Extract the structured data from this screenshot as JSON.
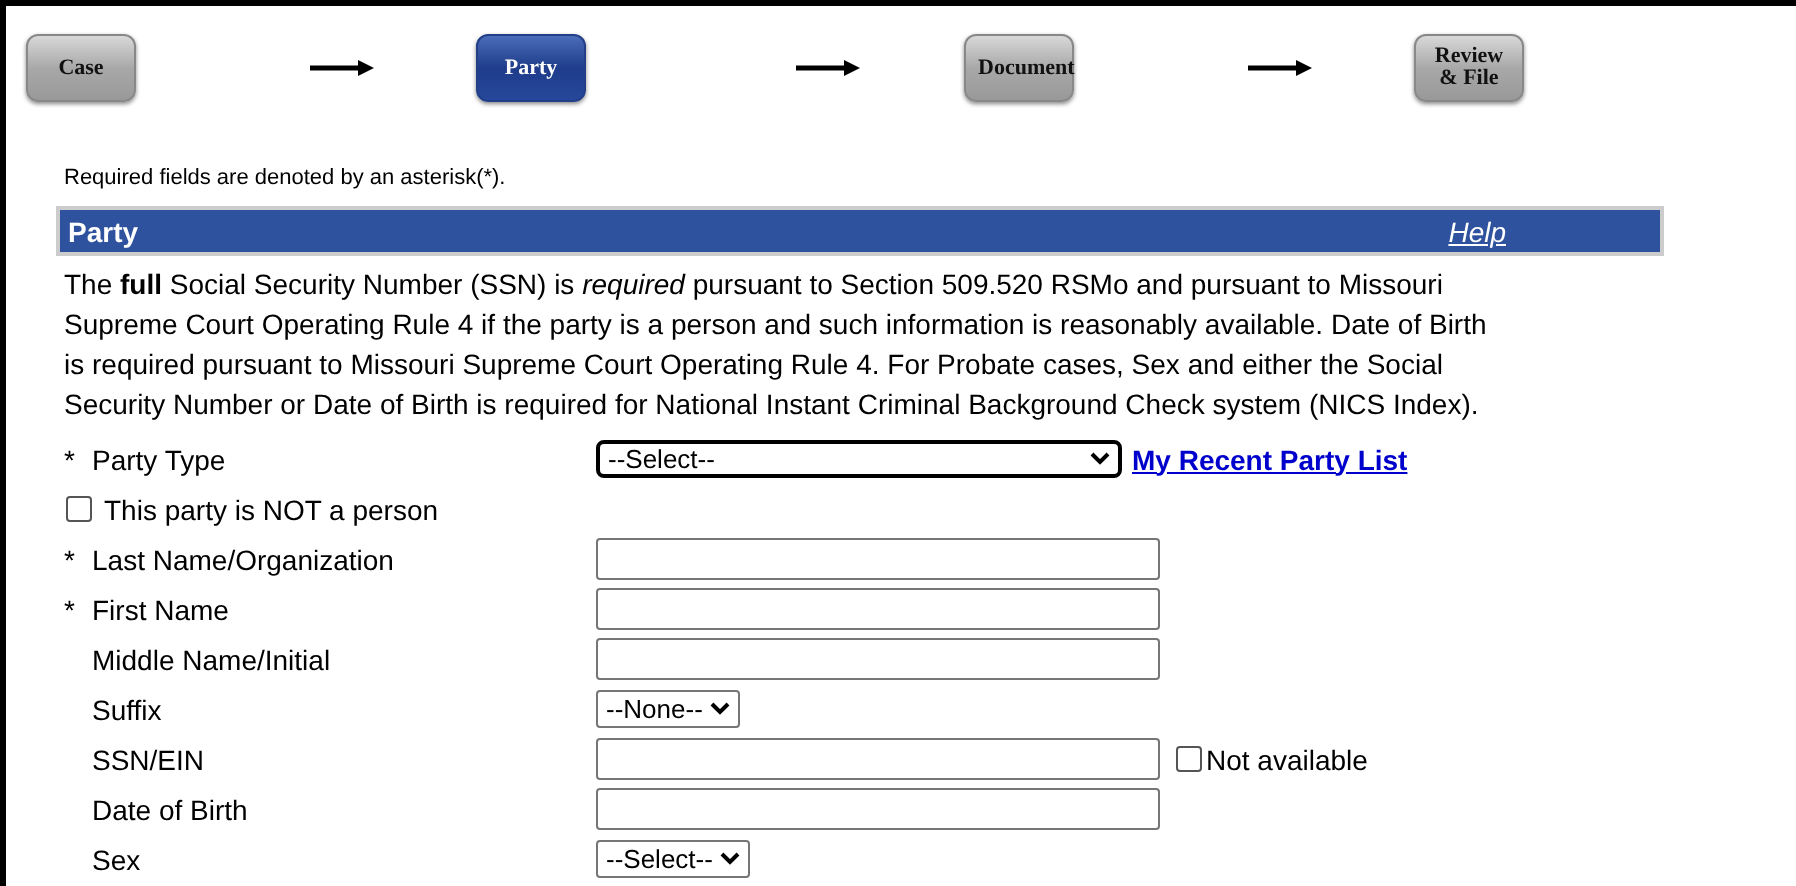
{
  "steps": [
    {
      "label": "Case",
      "selected": false
    },
    {
      "label": "Party",
      "selected": true
    },
    {
      "label": "Document",
      "selected": false
    },
    {
      "label": "Review & File",
      "selected": false
    }
  ],
  "required_note": "Required fields are denoted by an asterisk(*).",
  "section": {
    "title": "Party",
    "help": "Help"
  },
  "notice": "The **full** Social Security Number (SSN) is *required* pursuant to Section 509.520 RSMo and pursuant to Missouri Supreme Court Operating Rule 4 if the party is a person and such information is reasonably available. Date of Birth is required pursuant to Missouri Supreme Court Operating Rule 4. For Probate cases, Sex and either the Social Security Number or Date of Birth is required for National Instant Criminal Background Check system (NICS Index).",
  "fields": [
    {
      "kind": "select",
      "marker": "*",
      "label": "Party Type",
      "value": "--Select--",
      "wide": true,
      "link": "My Recent Party List"
    },
    {
      "kind": "checkbox",
      "label": "This party is NOT a person",
      "checked": false
    },
    {
      "kind": "text",
      "marker": "*",
      "label": "Last Name/Organization"
    },
    {
      "kind": "text",
      "marker": "*",
      "label": "First Name"
    },
    {
      "kind": "text",
      "label": "Middle Name/Initial"
    },
    {
      "kind": "select",
      "label": "Suffix",
      "value": "--None--",
      "wide": false
    },
    {
      "kind": "text",
      "label": "SSN/EIN",
      "extra": {
        "label": "Not available",
        "checked": false
      }
    },
    {
      "kind": "text",
      "label": "Date of Birth"
    },
    {
      "kind": "select",
      "label": "Sex",
      "value": "--Select--",
      "wide": false
    }
  ]
}
